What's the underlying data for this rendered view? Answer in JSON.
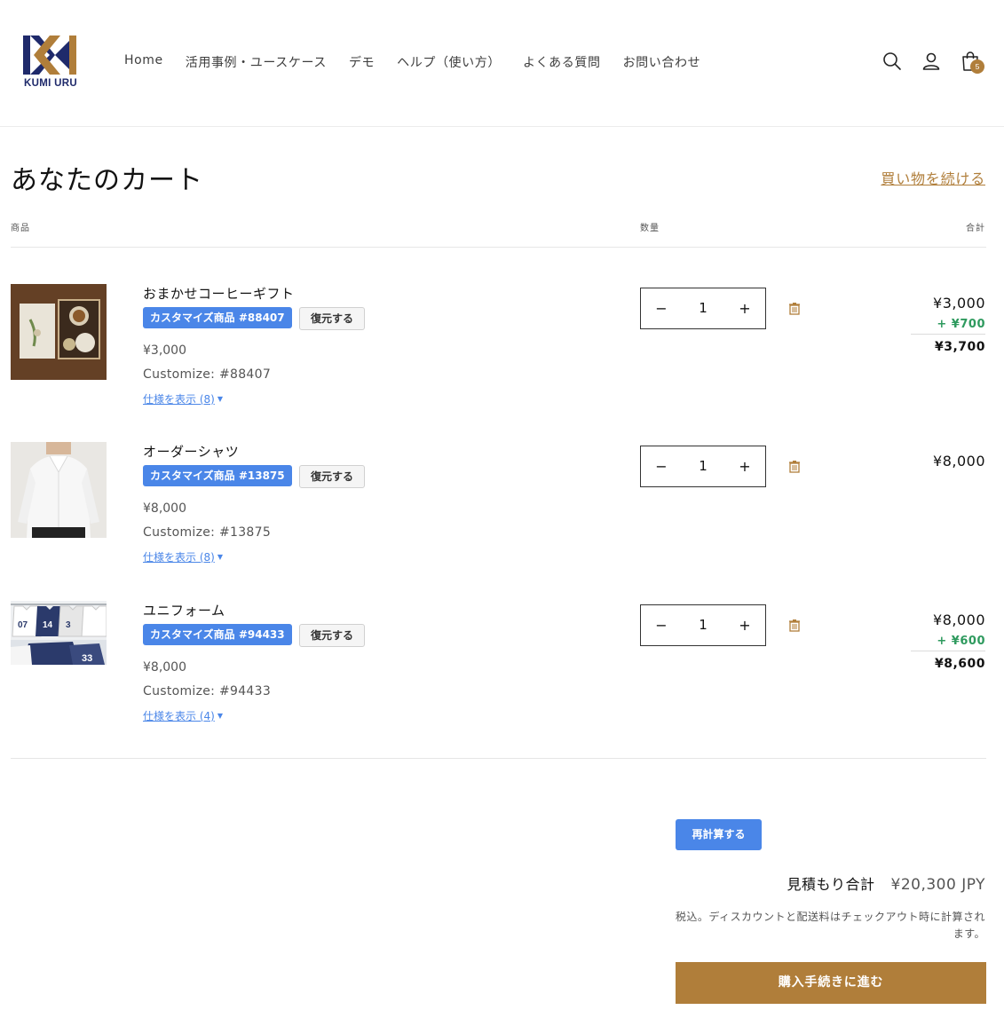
{
  "brand": {
    "logo_text": "KUMI URU",
    "colors": {
      "navy": "#1f2a6b",
      "gold": "#b07e3a",
      "blue": "#4a86e8",
      "green": "#2e9a5e"
    }
  },
  "nav": {
    "items": [
      {
        "label": "Home"
      },
      {
        "label": "活用事例・ユースケース"
      },
      {
        "label": "デモ"
      },
      {
        "label": "ヘルプ（使い方）"
      },
      {
        "label": "よくある質問"
      },
      {
        "label": "お問い合わせ"
      }
    ]
  },
  "header_icons": {
    "search": "search-icon",
    "account": "user-icon",
    "cart": "shopping-bag-icon",
    "cart_count": "5"
  },
  "cart": {
    "title": "あなたのカート",
    "continue_label": "買い物を続ける",
    "col_product": "商品",
    "col_quantity": "数量",
    "col_total": "合計",
    "items": [
      {
        "name": "おまかせコーヒーギフト",
        "badge": "カスタマイズ商品 #88407",
        "restore_label": "復元する",
        "price": "¥3,000",
        "customize": "Customize: #88407",
        "spec_label": "仕様を表示 (8)",
        "quantity": "1",
        "line_base": "¥3,000",
        "line_add": "+ ¥700",
        "line_total": "¥3,700"
      },
      {
        "name": "オーダーシャツ",
        "badge": "カスタマイズ商品 #13875",
        "restore_label": "復元する",
        "price": "¥8,000",
        "customize": "Customize: #13875",
        "spec_label": "仕様を表示 (8)",
        "quantity": "1",
        "line_base": "¥8,000"
      },
      {
        "name": "ユニフォーム",
        "badge": "カスタマイズ商品 #94433",
        "restore_label": "復元する",
        "price": "¥8,000",
        "customize": "Customize: #94433",
        "spec_label": "仕様を表示 (4)",
        "quantity": "1",
        "line_base": "¥8,000",
        "line_add": "+ ¥600",
        "line_total": "¥8,600"
      }
    ],
    "recalc_label": "再計算する",
    "estimate_label": "見積もり合計",
    "estimate_value": "¥20,300 JPY",
    "tax_note": "税込。ディスカウントと配送料はチェックアウト時に計算されます。",
    "checkout_label": "購入手続きに進む"
  }
}
